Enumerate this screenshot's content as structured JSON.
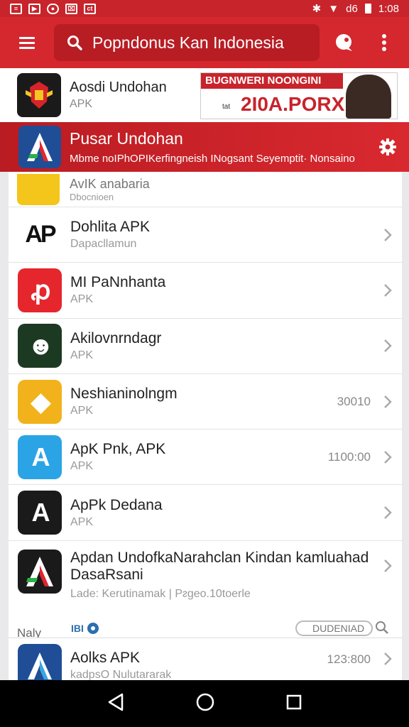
{
  "status_bar": {
    "time": "1:08",
    "signal_text": "d6"
  },
  "app_bar": {
    "search_text": "Popndonus Kan Indonesia",
    "menu_icon": "hamburger-icon",
    "action_icon": "chat-bubble-icon",
    "overflow_icon": "more-vert-icon"
  },
  "banner": {
    "app_title": "Aosdi Undohan",
    "app_sub": "APK",
    "promo_top": "BUGNWERI NOONGINI",
    "promo_small": "tat",
    "promo_big": "2I0A.PORX"
  },
  "header": {
    "title": "Pusar Undohan",
    "subtitle": "Mbme noIPhOPIKerfingneish INogsant Seyemptit· Nonsaino"
  },
  "partial_item": {
    "title": "AvIK anabaria",
    "sub": "Dbocnioen"
  },
  "items": [
    {
      "title": "Dohlita APK",
      "sub": "Dapacllamun",
      "meta": "",
      "icon_bg": "#ffffff",
      "icon_glyph": "AP"
    },
    {
      "title": "MI PaNnhanta",
      "sub": "APK",
      "meta": "",
      "icon_bg": "#e5262d",
      "icon_glyph": "ꝓ"
    },
    {
      "title": "Akilovnrndagr",
      "sub": "APK",
      "meta": "",
      "icon_bg": "#1c3a22",
      "icon_glyph": "☻"
    },
    {
      "title": "Neshianinolngm",
      "sub": "APK",
      "meta": "30010",
      "icon_bg": "#f2b21c",
      "icon_glyph": "◆"
    },
    {
      "title": "ApK Pnk, APK",
      "sub": "APK",
      "meta": "1100:00",
      "icon_bg": "#2ba4e6",
      "icon_glyph": "A"
    },
    {
      "title": "ApPk Dedana",
      "sub": "APK",
      "meta": "",
      "icon_bg": "#1a1a1a",
      "icon_glyph": "A"
    }
  ],
  "tall_item": {
    "title": "Apdan UndofkaNarahclan Kindan kamluahad DasaRsani",
    "sub": "Lade: Kerutinamak | Pᴤgeo.10toerle",
    "foot_label": "Naly",
    "foot_badges": "IBI",
    "foot_button": "DUDENIAD"
  },
  "bottom_item": {
    "title": "Aolks APK",
    "sub": "kadpsO Nulutararak",
    "meta": "123:800"
  },
  "colors": {
    "brand_red": "#d5272e",
    "dark_red": "#b81d24"
  }
}
